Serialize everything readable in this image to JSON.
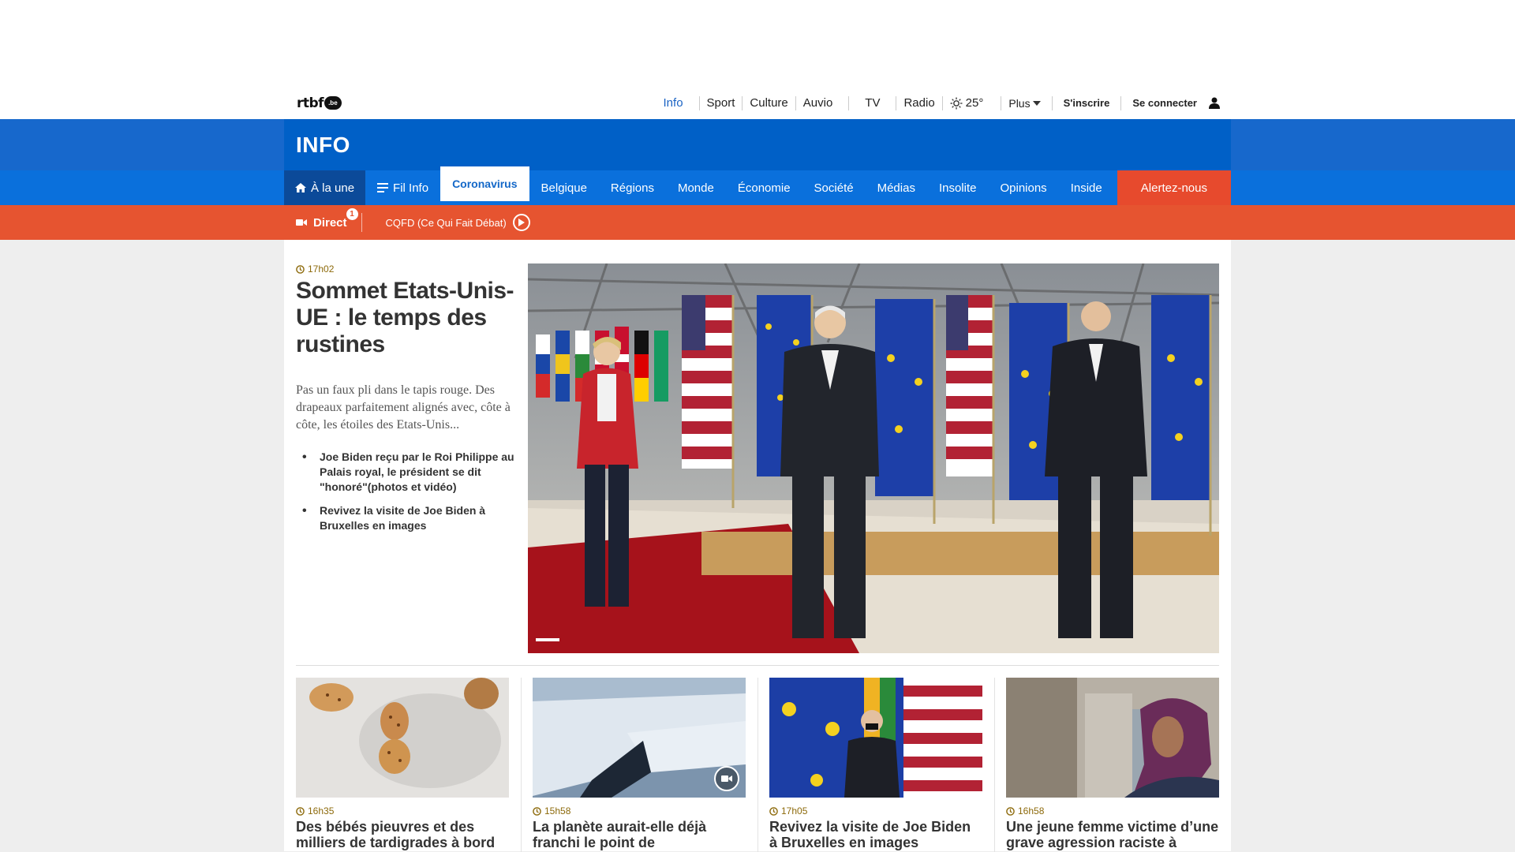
{
  "brand": {
    "logo_text": "rtbf",
    "logo_badge": ".be"
  },
  "topnav": {
    "items": [
      "Info",
      "Sport",
      "Culture",
      "Auvio",
      "TV",
      "Radio"
    ],
    "weather": "25°",
    "more": "Plus",
    "signup": "S'inscrire",
    "login": "Se connecter"
  },
  "section": {
    "title": "INFO"
  },
  "secnav": {
    "home": "À la une",
    "fil": "Fil Info",
    "tabs": [
      "Coronavirus",
      "Belgique",
      "Régions",
      "Monde",
      "Économie",
      "Société",
      "Médias",
      "Insolite",
      "Opinions",
      "Inside"
    ],
    "alert": "Alertez-nous"
  },
  "direct": {
    "label": "Direct",
    "badge": "1",
    "program": "CQFD (Ce Qui Fait Débat)"
  },
  "hero": {
    "time": "17h02",
    "title": "Sommet Etats-Unis-UE : le temps des rustines",
    "lead": "Pas un faux pli dans le tapis rouge. Des drapeaux parfaitement alignés avec, côte à côte, les étoiles des Etats-Unis...",
    "related": [
      "Joe Biden reçu par le Roi Philippe au Palais royal, le président se dit \"honoré\"(photos et vidéo)",
      "Revivez la visite de Joe Biden à Bruxelles en images"
    ]
  },
  "cards": [
    {
      "time": "16h35",
      "title": "Des bébés pieuvres et des milliers de tardigrades à bord de"
    },
    {
      "time": "15h58",
      "title": "La planète aurait-elle déjà franchi le point de basculement",
      "video": true
    },
    {
      "time": "17h05",
      "title": "Revivez la visite de Joe Biden à Bruxelles en images"
    },
    {
      "time": "16h58",
      "title": "Une jeune femme victime d’une grave agression raciste à"
    }
  ],
  "colors": {
    "primary": "#0060c7",
    "nav": "#0a70dc",
    "direct": "#e65430",
    "time": "#8d6a0b"
  }
}
